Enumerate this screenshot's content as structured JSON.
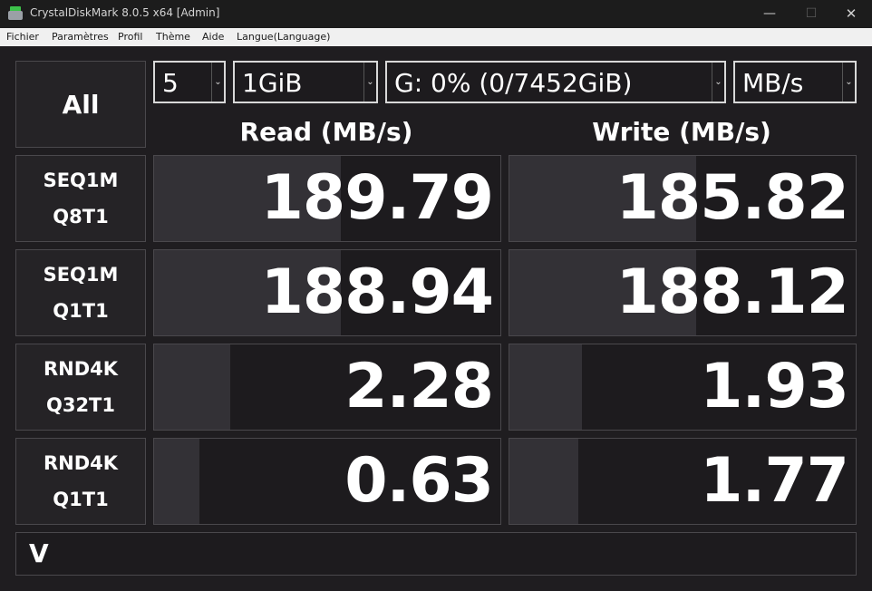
{
  "window": {
    "title": "CrystalDiskMark 8.0.5 x64 [Admin]",
    "minimize_glyph": "—",
    "maximize_glyph": "☐",
    "close_glyph": "✕"
  },
  "menu": [
    "Fichier",
    "Paramètres",
    "Profil",
    "Thème",
    "Aide",
    "Langue(Language)"
  ],
  "controls": {
    "all_label": "All",
    "count": "5",
    "size": "1GiB",
    "drive": "G: 0% (0/7452GiB)",
    "unit": "MB/s",
    "dropdown_glyph": "⌄"
  },
  "headers": {
    "read": "Read (MB/s)",
    "write": "Write (MB/s)"
  },
  "tests": [
    {
      "line1": "SEQ1M",
      "line2": "Q8T1",
      "read": "189.79",
      "write": "185.82",
      "read_fill": 0.54,
      "write_fill": 0.54
    },
    {
      "line1": "SEQ1M",
      "line2": "Q1T1",
      "read": "188.94",
      "write": "188.12",
      "read_fill": 0.54,
      "write_fill": 0.54
    },
    {
      "line1": "RND4K",
      "line2": "Q32T1",
      "read": "2.28",
      "write": "1.93",
      "read_fill": 0.22,
      "write_fill": 0.21
    },
    {
      "line1": "RND4K",
      "line2": "Q1T1",
      "read": "0.63",
      "write": "1.77",
      "read_fill": 0.13,
      "write_fill": 0.2
    }
  ],
  "comment": "V",
  "colors": {
    "background": "#1f1d20",
    "tile": "#252326",
    "bar": "#333136",
    "border": "#4a484c",
    "text": "#ffffff"
  }
}
